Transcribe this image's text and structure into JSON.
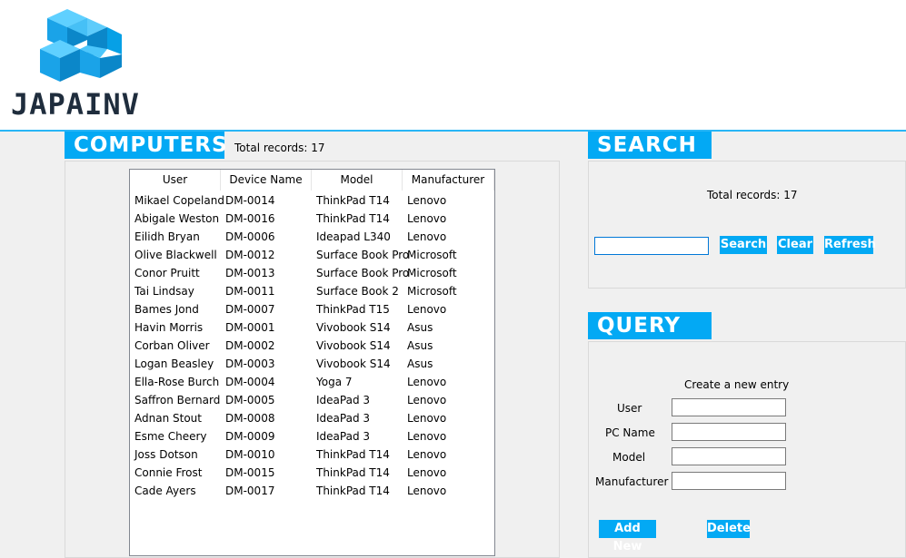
{
  "app": {
    "logo_text": "JAPAINV",
    "accent": "#03a9f4",
    "header_line": "#29b6f6"
  },
  "computers": {
    "title": "COMPUTERS",
    "total_records": "Total records: 17",
    "columns": [
      "User",
      "Device Name",
      "Model",
      "Manufacturer"
    ],
    "rows": [
      [
        "Mikael Copeland",
        "DM-0014",
        "ThinkPad T14",
        "Lenovo"
      ],
      [
        "Abigale Weston",
        "DM-0016",
        "ThinkPad T14",
        "Lenovo"
      ],
      [
        "Eilidh Bryan",
        "DM-0006",
        "Ideapad L340",
        "Lenovo"
      ],
      [
        "Olive Blackwell",
        "DM-0012",
        "Surface Book Pro",
        "Microsoft"
      ],
      [
        "Conor Pruitt",
        "DM-0013",
        "Surface Book Pro",
        "Microsoft"
      ],
      [
        "Tai Lindsay",
        "DM-0011",
        "Surface Book 2",
        "Microsoft"
      ],
      [
        "Bames Jond",
        "DM-0007",
        "ThinkPad T15",
        "Lenovo"
      ],
      [
        "Havin Morris",
        "DM-0001",
        "Vivobook S14",
        "Asus"
      ],
      [
        "Corban Oliver",
        "DM-0002",
        "Vivobook S14",
        "Asus"
      ],
      [
        "Logan Beasley",
        "DM-0003",
        "Vivobook S14",
        "Asus"
      ],
      [
        "Ella-Rose Burch",
        "DM-0004",
        "Yoga 7",
        "Lenovo"
      ],
      [
        "Saffron Bernard",
        "DM-0005",
        "IdeaPad 3",
        "Lenovo"
      ],
      [
        "Adnan Stout",
        "DM-0008",
        "IdeaPad 3",
        "Lenovo"
      ],
      [
        "Esme Cheery",
        "DM-0009",
        "IdeaPad 3",
        "Lenovo"
      ],
      [
        "Joss Dotson",
        "DM-0010",
        "ThinkPad T14",
        "Lenovo"
      ],
      [
        "Connie Frost",
        "DM-0015",
        "ThinkPad T14",
        "Lenovo"
      ],
      [
        "Cade Ayers",
        "DM-0017",
        "ThinkPad T14",
        "Lenovo"
      ]
    ]
  },
  "search": {
    "title": "SEARCH",
    "total_records": "Total records: 17",
    "input_value": "",
    "search_label": "Search",
    "clear_label": "Clear",
    "refresh_label": "Refresh"
  },
  "query": {
    "title": "QUERY",
    "subtitle": "Create a new entry",
    "user_label": "User",
    "pc_name_label": "PC Name",
    "model_label": "Model",
    "manufacturer_label": "Manufacturer",
    "user_value": "",
    "pc_name_value": "",
    "model_value": "",
    "manufacturer_value": "",
    "add_label": "Add New",
    "delete_label": "Delete"
  }
}
